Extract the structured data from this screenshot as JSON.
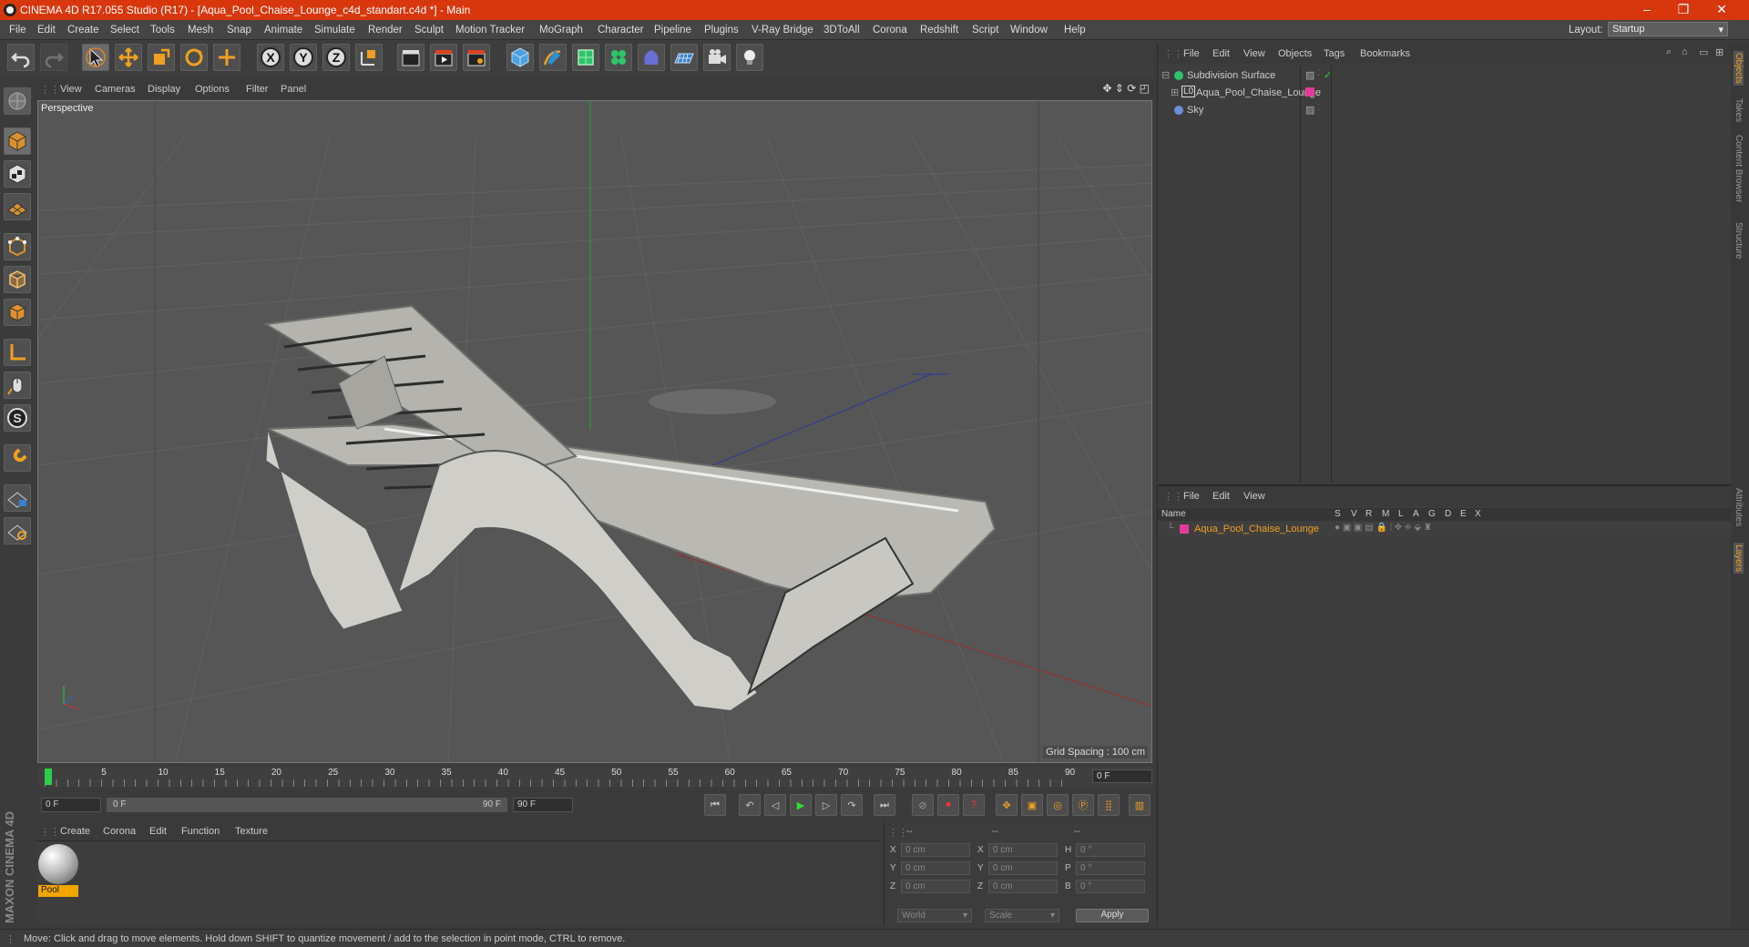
{
  "window": {
    "title": "CINEMA 4D R17.055 Studio (R17) - [Aqua_Pool_Chaise_Lounge_c4d_standart.c4d *] - Main",
    "minimize": "–",
    "restore": "❐",
    "close": "✕"
  },
  "menubar": {
    "items": [
      "File",
      "Edit",
      "Create",
      "Select",
      "Tools",
      "Mesh",
      "Snap",
      "Animate",
      "Simulate",
      "Render",
      "Sculpt",
      "Motion Tracker",
      "MoGraph",
      "Character",
      "Pipeline",
      "Plugins",
      "V-Ray Bridge",
      "3DToAll",
      "Corona",
      "Redshift",
      "Script",
      "Window",
      "Help"
    ],
    "layout_label": "Layout:",
    "layout_value": "Startup"
  },
  "viewport": {
    "menu": [
      "View",
      "Cameras",
      "Display",
      "Options",
      "Filter",
      "Panel"
    ],
    "label": "Perspective",
    "grid_spacing": "Grid Spacing : 100 cm"
  },
  "timeline": {
    "ticks": [
      "0",
      "5",
      "10",
      "15",
      "20",
      "25",
      "30",
      "35",
      "40",
      "45",
      "50",
      "55",
      "60",
      "65",
      "70",
      "75",
      "80",
      "85",
      "90"
    ],
    "current_frame": "0 F"
  },
  "transport": {
    "start_field": "0 F",
    "range_start": "0 F",
    "range_end": "90 F",
    "end_field": "90 F"
  },
  "material": {
    "menu": [
      "Create",
      "Corona",
      "Edit",
      "Function",
      "Texture"
    ],
    "name": "Pool"
  },
  "coordinates": {
    "col1": "--",
    "col2": "--",
    "col3": "--",
    "rows": [
      {
        "a": "X",
        "v1": "0 cm",
        "b": "X",
        "v2": "0 cm",
        "c": "H",
        "v3": "0 °"
      },
      {
        "a": "Y",
        "v1": "0 cm",
        "b": "Y",
        "v2": "0 cm",
        "c": "P",
        "v3": "0 °"
      },
      {
        "a": "Z",
        "v1": "0 cm",
        "b": "Z",
        "v2": "0 cm",
        "c": "B",
        "v3": "0 °"
      }
    ],
    "world": "World",
    "scale": "Scale",
    "apply": "Apply"
  },
  "objects": {
    "menu": [
      "File",
      "Edit",
      "View",
      "Objects",
      "Tags",
      "Bookmarks"
    ],
    "items": [
      {
        "name": "Subdivision Surface",
        "color": "#2ec46b"
      },
      {
        "name": "Aqua_Pool_Chaise_Lounge",
        "color": "#e23a9a"
      },
      {
        "name": "Sky",
        "color": "#6b8fd6"
      }
    ]
  },
  "side_tabs": [
    "Objects",
    "Takes",
    "Content Browser",
    "Structure",
    "Attributes",
    "Layers"
  ],
  "layers": {
    "menu": [
      "File",
      "Edit",
      "View"
    ],
    "headers": [
      "Name",
      "S",
      "V",
      "R",
      "M",
      "L",
      "A",
      "G",
      "D",
      "E",
      "X"
    ],
    "row_name": "Aqua_Pool_Chaise_Lounge",
    "row_color": "#e23a9a"
  },
  "status": {
    "text": "Move: Click and drag to move elements. Hold down SHIFT to quantize movement / add to the selection in point mode, CTRL to remove."
  },
  "branding": {
    "text": "MAXON CINEMA 4D"
  }
}
